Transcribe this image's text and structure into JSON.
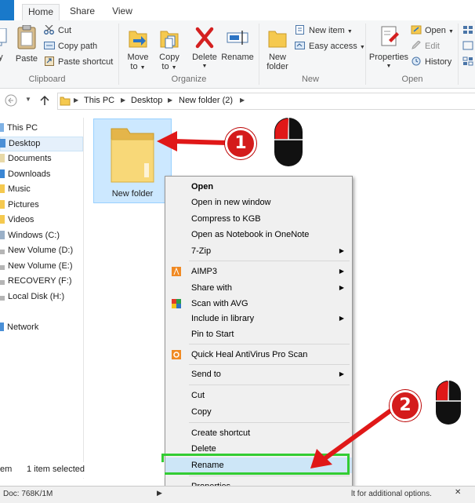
{
  "tabs": {
    "file": "",
    "home": "Home",
    "share": "Share",
    "view": "View"
  },
  "ribbon": {
    "clipboard": {
      "copy_partial": "py",
      "paste": "Paste",
      "cut": "Cut",
      "copy_path": "Copy path",
      "paste_shortcut": "Paste shortcut",
      "group": "Clipboard"
    },
    "organize": {
      "move_to_1": "Move",
      "move_to_2": "to",
      "copy_to_1": "Copy",
      "copy_to_2": "to",
      "delete": "Delete",
      "rename": "Rename",
      "group": "Organize"
    },
    "new": {
      "new_folder_1": "New",
      "new_folder_2": "folder",
      "new_item": "New item",
      "easy_access": "Easy access",
      "group": "New"
    },
    "open": {
      "properties": "Properties",
      "open": "Open",
      "edit": "Edit",
      "history": "History",
      "group": "Open"
    }
  },
  "address": {
    "crumbs": [
      "This PC",
      "Desktop",
      "New folder (2)"
    ]
  },
  "nav": {
    "items": [
      {
        "label": "This PC"
      },
      {
        "label": "Desktop"
      },
      {
        "label": "Documents"
      },
      {
        "label": "Downloads"
      },
      {
        "label": "Music"
      },
      {
        "label": "Pictures"
      },
      {
        "label": "Videos"
      },
      {
        "label": "Windows (C:)"
      },
      {
        "label": "New Volume (D:)"
      },
      {
        "label": "New Volume (E:)"
      },
      {
        "label": "RECOVERY (F:)"
      },
      {
        "label": "Local Disk (H:)"
      },
      {
        "label": "Network"
      }
    ]
  },
  "content": {
    "folder_name": "New folder"
  },
  "context_menu": {
    "items": [
      {
        "label": "Open"
      },
      {
        "label": "Open in new window"
      },
      {
        "label": "Compress to KGB"
      },
      {
        "label": "Open as Notebook in OneNote"
      },
      {
        "label": "7-Zip"
      },
      {
        "label": "AIMP3"
      },
      {
        "label": "Share with"
      },
      {
        "label": "Scan with AVG"
      },
      {
        "label": "Include in library"
      },
      {
        "label": "Pin to Start"
      },
      {
        "label": "Quick Heal AntiVirus Pro Scan"
      },
      {
        "label": "Send to"
      },
      {
        "label": "Cut"
      },
      {
        "label": "Copy"
      },
      {
        "label": "Create shortcut"
      },
      {
        "label": "Delete"
      },
      {
        "label": "Rename"
      },
      {
        "label": "Properties"
      }
    ]
  },
  "status": {
    "items_partial": "em",
    "selected": "1 item selected"
  },
  "bottom": {
    "doc": "Doc: 768K/1M",
    "hint": "lt for additional options."
  },
  "annotations": {
    "step1": "1",
    "step2": "2"
  },
  "colors": {
    "accent": "#1979ca",
    "annotation_red": "#d41b1b",
    "highlight_green": "#33cc33",
    "selection": "#cce8ff"
  }
}
